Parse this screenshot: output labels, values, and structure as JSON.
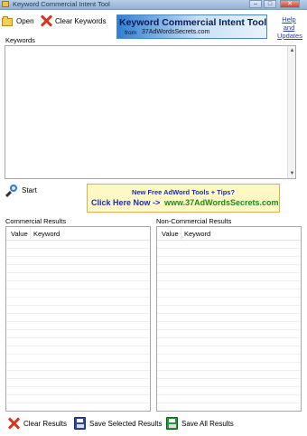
{
  "window": {
    "title": "Keyword Commercial Intent Tool",
    "min": "–",
    "max": "□",
    "close": "✕"
  },
  "toolbar": {
    "open_label": "Open",
    "clear_keywords_label": "Clear Keywords"
  },
  "banner": {
    "title": "Keyword Commercial Intent Tool",
    "from": "from",
    "url": "37AdWordsSecrets.com"
  },
  "help": {
    "line1": "Help",
    "line2": "and",
    "line3": "Updates"
  },
  "keywords": {
    "label": "Keywords",
    "value": ""
  },
  "start_label": "Start",
  "promo": {
    "line1": "New Free AdWord Tools + Tips?",
    "line2": "Click Here Now ->",
    "url": "www.37AdWordsSecrets.com"
  },
  "commercial": {
    "label": "Commercial Results",
    "columns": [
      "Value",
      "Keyword"
    ]
  },
  "noncommercial": {
    "label": "Non-Commercial Results",
    "columns": [
      "Value",
      "Keyword"
    ]
  },
  "bottom": {
    "clear_results": "Clear Results",
    "save_selected": "Save Selected Results",
    "save_all": "Save All Results"
  },
  "icons": {
    "open": "folder-open-icon",
    "clear": "red-x-icon",
    "start": "magnifier-icon",
    "save": "floppy-disk-icon"
  },
  "colors": {
    "promo_blue": "#1a2fb0",
    "promo_green": "#1d8a1d",
    "clear_red": "#d8341f"
  }
}
